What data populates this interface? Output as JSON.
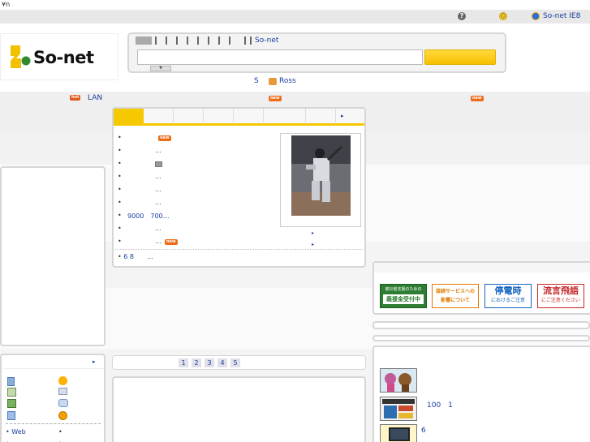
{
  "top": {
    "left_text": "¥n"
  },
  "topbar": {
    "so_net_ie8": "So-net IE8"
  },
  "search": {
    "tabs": [
      "",
      "",
      "",
      "",
      "",
      "",
      "",
      "",
      "",
      "So-net"
    ],
    "query": "",
    "button": ""
  },
  "subnav": {
    "s": "S",
    "ross": "Ross"
  },
  "tickerbar": {
    "hot_badge": "hot",
    "lan": "LAN",
    "new_badge1": "new",
    "new_badge2": "new"
  },
  "news": {
    "tabs": [
      "",
      "",
      "",
      "",
      "",
      "",
      ""
    ],
    "more": "▸",
    "items": [
      {
        "text": "",
        "badge": "new"
      },
      {
        "text": "…",
        "badge": ""
      },
      {
        "text": "",
        "badge": ""
      },
      {
        "text": "…",
        "badge": ""
      },
      {
        "text": "…",
        "badge": ""
      },
      {
        "text": "…",
        "badge": ""
      },
      {
        "text": "9000　700…",
        "badge": ""
      },
      {
        "text": "…",
        "badge": ""
      },
      {
        "text": "…",
        "badge": "new"
      },
      {
        "text": "6 8　　…",
        "badge": ""
      }
    ]
  },
  "pager": {
    "pages": [
      "1",
      "2",
      "3",
      "4",
      "5"
    ]
  },
  "leftlower": {
    "more": "▸",
    "web": "Web"
  },
  "banners": [
    {
      "line1": "被災者支援のための",
      "line2": "義援金受付中",
      "color": "#2e7d32"
    },
    {
      "line1": "接続サービスへの",
      "line2": "影響について",
      "color": "#e07b00"
    },
    {
      "line1": "停電時",
      "line2": "におけるご注意",
      "color": "#1565c0"
    },
    {
      "line1": "流言飛語",
      "line2": "にご注意ください",
      "color": "#c62828"
    }
  ],
  "rightlist": {
    "item1": "100　1",
    "item2": "6"
  },
  "colors": {
    "link": "#1a3d9c",
    "accent_yellow": "#f6c800",
    "new_badge": "#ee6b1a",
    "logo_yellow": "#f2c100"
  }
}
